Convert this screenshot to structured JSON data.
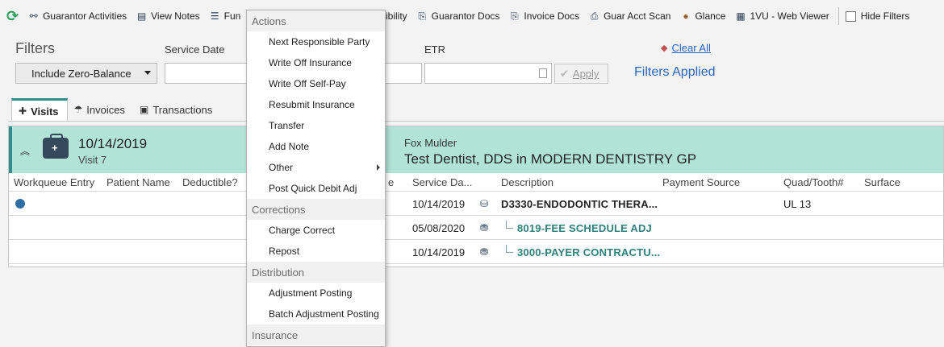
{
  "toolbar": {
    "items": [
      {
        "label": "Guarantor Activities",
        "icon": "people-tree-icon"
      },
      {
        "label": "View Notes",
        "icon": "notes-icon"
      },
      {
        "label": "Fun",
        "icon": "list-icon"
      },
      {
        "label": "al Eligibility",
        "icon": ""
      },
      {
        "label": "Guarantor Docs",
        "icon": "docs-scan-icon"
      },
      {
        "label": "Invoice Docs",
        "icon": "docs-scan-icon"
      },
      {
        "label": "Guar Acct Scan",
        "icon": "scanner-icon"
      },
      {
        "label": "Glance",
        "icon": "person-icon"
      },
      {
        "label": "1VU - Web Viewer",
        "icon": "film-icon"
      }
    ],
    "hide_filters": "Hide Filters"
  },
  "filters": {
    "title": "Filters",
    "service_date_label": "Service Date",
    "etr_label": "ETR",
    "zero_balance_value": "Include Zero-Balance",
    "apply_label": "Apply",
    "clear_all": "Clear All",
    "filters_applied": "Filters Applied"
  },
  "tabs": [
    {
      "label": "Visits",
      "icon": "medkit-icon",
      "active": true
    },
    {
      "label": "Invoices",
      "icon": "umbrella-icon",
      "active": false
    },
    {
      "label": "Transactions",
      "icon": "money-icon",
      "active": false
    }
  ],
  "visit": {
    "date": "10/14/2019",
    "visit_number": "Visit 7",
    "provider_name": "Fox Mulder",
    "provider_desc": "Test Dentist, DDS in MODERN DENTISTRY GP"
  },
  "grid": {
    "columns": [
      "Workqueue Entry",
      "Patient Name",
      "Deductible?",
      "e",
      "Service Da...",
      "Description",
      "Payment Source",
      "Quad/Tooth#",
      "Surface"
    ],
    "rows": [
      {
        "service_date": "10/14/2019",
        "description": "D3330-ENDODONTIC THERA...",
        "quad_tooth": "UL 13",
        "has_workqueue": true
      },
      {
        "service_date": "05/08/2020",
        "description": "8019-FEE SCHEDULE ADJ",
        "quad_tooth": "",
        "has_workqueue": false
      },
      {
        "service_date": "10/14/2019",
        "description": "3000-PAYER CONTRACTU...",
        "quad_tooth": "",
        "has_workqueue": false
      }
    ]
  },
  "menu": {
    "groups": [
      {
        "label": "Actions",
        "items": [
          "Next Responsible Party",
          "Write Off Insurance",
          "Write Off Self-Pay",
          "Resubmit Insurance",
          "Transfer",
          "Add Note",
          "Other",
          "Post Quick Debit Adj"
        ]
      },
      {
        "label": "Corrections",
        "items": [
          "Charge Correct",
          "Repost"
        ]
      },
      {
        "label": "Distribution",
        "items": [
          "Adjustment Posting",
          "Batch Adjustment Posting"
        ]
      },
      {
        "label": "Insurance",
        "items": []
      }
    ]
  },
  "colors": {
    "accent": "#2f8f8a",
    "visit_header": "#b2e3d7",
    "link": "#2b63c9",
    "refresh": "#2a9d5c"
  }
}
